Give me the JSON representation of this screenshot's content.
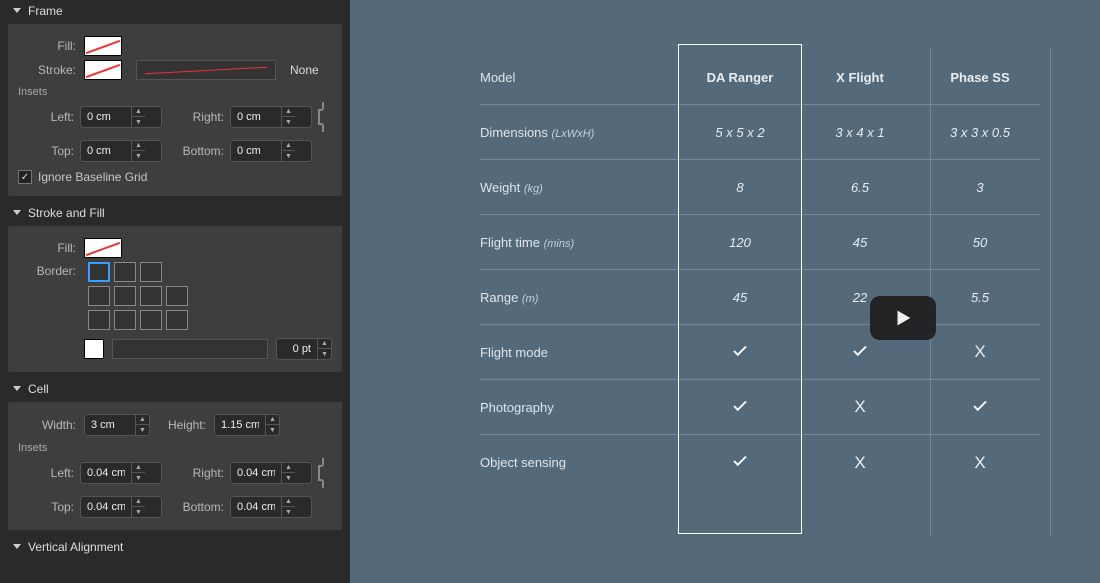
{
  "panel": {
    "sections": {
      "frame": {
        "title": "Frame",
        "fill_label": "Fill:",
        "stroke_label": "Stroke:",
        "stroke_style": "None",
        "insets_label": "Insets",
        "left_label": "Left:",
        "right_label": "Right:",
        "top_label": "Top:",
        "bottom_label": "Bottom:",
        "left": "0 cm",
        "right": "0 cm",
        "top": "0 cm",
        "bottom": "0 cm",
        "ignore_baseline": "Ignore Baseline Grid"
      },
      "strokefill": {
        "title": "Stroke and Fill",
        "fill_label": "Fill:",
        "border_label": "Border:",
        "stroke_weight": "0 pt"
      },
      "cell": {
        "title": "Cell",
        "width_label": "Width:",
        "height_label": "Height:",
        "width": "3 cm",
        "height": "1.15 cm",
        "insets_label": "Insets",
        "left_label": "Left:",
        "right_label": "Right:",
        "top_label": "Top:",
        "bottom_label": "Bottom:",
        "left": "0.04 cm",
        "right": "0.04 cm",
        "top": "0.04 cm",
        "bottom": "0.04 cm"
      },
      "valign": {
        "title": "Vertical Alignment"
      }
    }
  },
  "table": {
    "header": [
      "Model",
      "DA Ranger",
      "X Flight",
      "Phase SS"
    ],
    "rows": [
      {
        "label": "Dimensions",
        "sub": "(LxWxH)",
        "cells": [
          "5 x 5 x 2",
          "3 x 4 x 1",
          "3 x 3 x 0.5"
        ]
      },
      {
        "label": "Weight",
        "sub": "(kg)",
        "cells": [
          "8",
          "6.5",
          "3"
        ]
      },
      {
        "label": "Flight time",
        "sub": "(mins)",
        "cells": [
          "120",
          "45",
          "50"
        ]
      },
      {
        "label": "Range",
        "sub": "(m)",
        "cells": [
          "45",
          "22",
          "5.5"
        ]
      },
      {
        "label": "Flight mode",
        "sub": "",
        "cells": [
          "✓",
          "✓",
          "X"
        ]
      },
      {
        "label": "Photography",
        "sub": "",
        "cells": [
          "✓",
          "X",
          "✓"
        ]
      },
      {
        "label": "Object sensing",
        "sub": "",
        "cells": [
          "✓",
          "X",
          "X"
        ]
      }
    ]
  }
}
